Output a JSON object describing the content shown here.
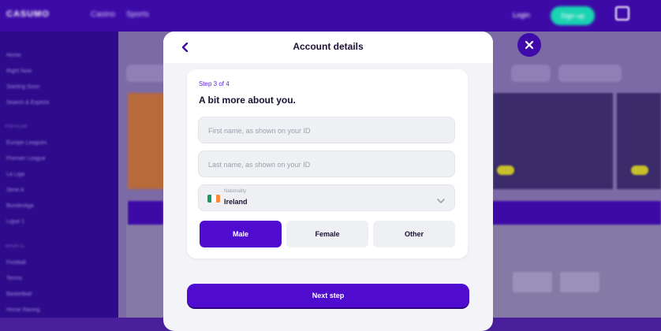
{
  "background": {
    "logo": "CASUMO",
    "nav": [
      "Casino",
      "Sports"
    ],
    "login": "Login",
    "signup": "Sign up",
    "sidebar_items": [
      "Home",
      "Right Now",
      "Starting Soon",
      "Search & Explore",
      "Europe Leagues",
      "Premier League",
      "La Liga",
      "Serie A",
      "Bundesliga",
      "Ligue 1",
      "Football",
      "Tennis",
      "Basketball",
      "Horse Racing"
    ],
    "sidebar_heads": [
      "POPULAR",
      "SPORTS"
    ]
  },
  "modal": {
    "title": "Account details",
    "back_icon": "chevron-left-icon",
    "close_icon": "close-icon",
    "step": "Step 3 of 4",
    "heading": "A bit more about you.",
    "first_name_placeholder": "First name, as shown on your ID",
    "last_name_placeholder": "Last name, as shown on your ID",
    "nationality_label": "Nationality",
    "nationality_value": "Ireland",
    "flag_icon": "ireland-flag-icon",
    "gender_options": [
      "Male",
      "Female",
      "Other"
    ],
    "gender_selected": "Male",
    "next_button": "Next step"
  },
  "colors": {
    "accent": "#4f0bd0",
    "background_purple": "#3d0aa8",
    "flag_green": "#169b62",
    "flag_white": "#ffffff",
    "flag_orange": "#ff883e"
  }
}
